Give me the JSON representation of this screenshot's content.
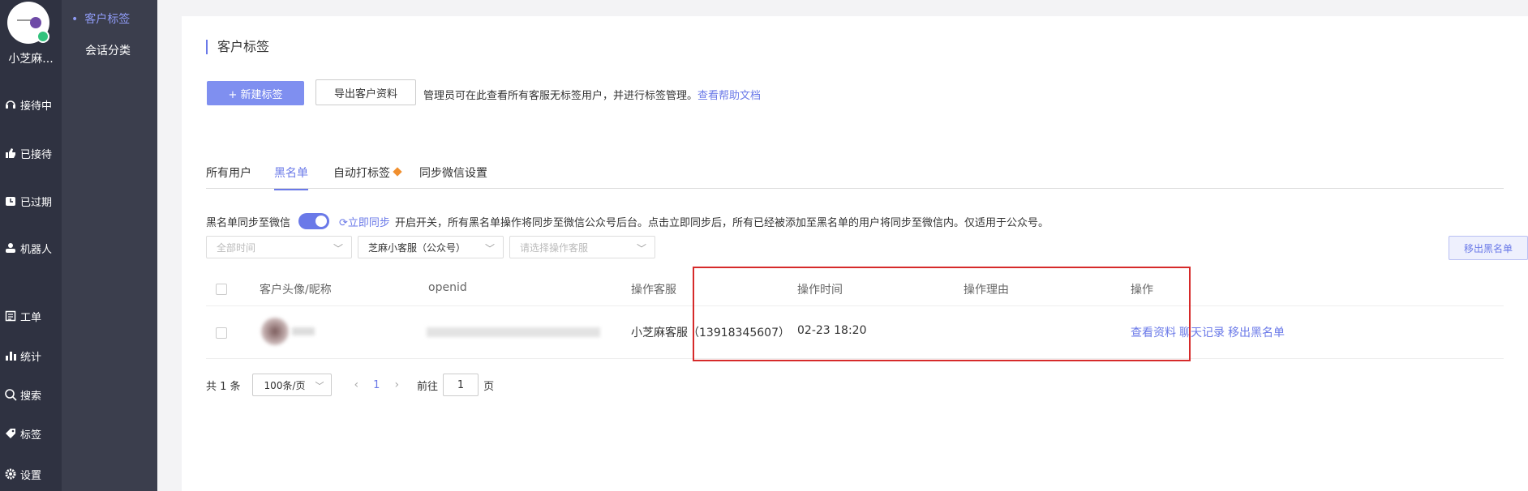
{
  "rail": {
    "username": "小芝麻...",
    "items": [
      {
        "label": "接待中",
        "icon": "headset-icon"
      },
      {
        "label": "已接待",
        "icon": "thumb-icon"
      },
      {
        "label": "已过期",
        "icon": "expired-icon"
      },
      {
        "label": "机器人",
        "icon": "robot-icon"
      },
      {
        "label": "工单",
        "icon": "ticket-icon"
      },
      {
        "label": "统计",
        "icon": "stats-icon"
      },
      {
        "label": "搜索",
        "icon": "search-icon"
      },
      {
        "label": "标签",
        "icon": "tag-icon"
      },
      {
        "label": "设置",
        "icon": "gear-icon"
      }
    ]
  },
  "subnav": {
    "items": [
      {
        "label": "客户标签",
        "active": true
      },
      {
        "label": "会话分类",
        "active": false
      }
    ]
  },
  "page": {
    "title": "客户标签",
    "new_tag_button": "+ 新建标签",
    "export_button": "导出客户资料",
    "tip_text": "管理员可在此查看所有客服无标签用户，并进行标签管理。",
    "tip_link": "查看帮助文档"
  },
  "tabs": [
    {
      "label": "所有用户",
      "active": false
    },
    {
      "label": "黑名单",
      "active": true
    },
    {
      "label": "自动打标签",
      "active": false
    },
    {
      "label": "同步微信设置",
      "active": false
    }
  ],
  "sync": {
    "label": "黑名单同步至微信",
    "enabled": true,
    "sync_now": "立即同步",
    "description": "开启开关，所有黑名单操作将同步至微信公众号后台。点击立即同步后，所有已经被添加至黑名单的用户将同步至微信内。仅适用于公众号。"
  },
  "filters": {
    "time_placeholder": "全部时间",
    "account_value": "芝麻小客服（公众号）",
    "operator_placeholder": "请选择操作客服",
    "remove_button": "移出黑名单"
  },
  "table": {
    "headers": {
      "avatar": "客户头像/昵称",
      "openid": "openid",
      "operator": "操作客服",
      "time": "操作时间",
      "reason": "操作理由",
      "actions": "操作"
    },
    "rows": [
      {
        "operator": "小芝麻客服（13918345607）",
        "time": "02-23 18:20",
        "reason": "",
        "actions": [
          "查看资料",
          "聊天记录",
          "移出黑名单"
        ]
      }
    ]
  },
  "pagination": {
    "total": "共 1 条",
    "page_size": "100条/页",
    "current": "1",
    "goto_label": "前往",
    "goto_value": "1",
    "page_suffix": "页"
  },
  "colors": {
    "accent": "#6a79e8",
    "primary_button": "#7f8ff0",
    "highlight_border": "#d62a2a",
    "rail_bg": "#2f3241",
    "subnav_bg": "#3b3e4d"
  }
}
